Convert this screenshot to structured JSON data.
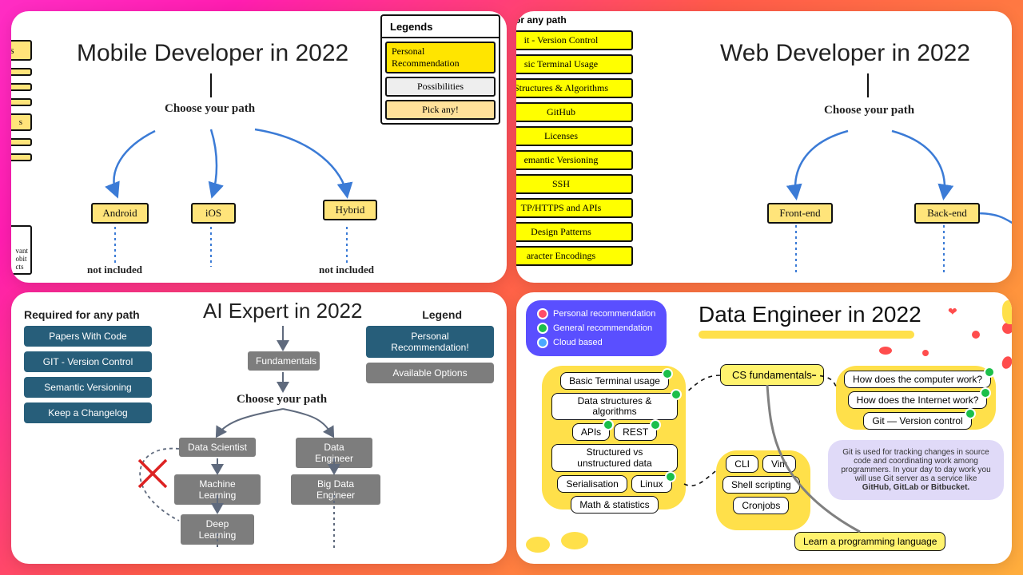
{
  "mobile": {
    "title": "Mobile Developer in 2022",
    "choose": "Choose your path",
    "paths": [
      "Android",
      "iOS",
      "Hybrid"
    ],
    "not_included": "not included",
    "legend_title": "Legends",
    "legend": [
      "Personal Recommendation",
      "Possibilities",
      "Pick any!"
    ],
    "crop_strip": [
      "ms"
    ]
  },
  "web": {
    "title": "Web Developer in 2022",
    "choose": "Choose your path",
    "paths": [
      "Front-end",
      "Back-end"
    ],
    "sidebar_title": "for any path",
    "sidebar": [
      "it - Version Control",
      "sic Terminal Usage",
      "Structures & Algorithms",
      "GitHub",
      "Licenses",
      "emantic Versioning",
      "SSH",
      "TP/HTTPS and APIs",
      "Design Patterns",
      "aracter Encodings"
    ]
  },
  "ai": {
    "title": "AI Expert in 2022",
    "choose": "Choose your path",
    "req_title": "Required for any path",
    "required": [
      "Papers With Code",
      "GIT - Version Control",
      "Semantic Versioning",
      "Keep a Changelog"
    ],
    "legend_title": "Legend",
    "legend": [
      "Personal Recommendation!",
      "Available Options"
    ],
    "nodes": {
      "fundamentals": "Fundamentals",
      "data_scientist": "Data Scientist",
      "data_engineer": "Data Engineer",
      "machine_learning": "Machine Learning",
      "big_data_engineer": "Big Data Engineer",
      "deep_learning": "Deep Learning"
    }
  },
  "de": {
    "title": "Data Engineer in 2022",
    "legend": {
      "personal": "Personal recommendation",
      "general": "General recommendation",
      "cloud": "Cloud based"
    },
    "root": "CS fundamentals",
    "left_group": [
      "Basic Terminal usage",
      "Data structures & algorithms",
      "APIs",
      "REST",
      "Structured vs unstructured data",
      "Serialisation",
      "Linux",
      "Math & statistics"
    ],
    "cli_group": [
      "CLI",
      "Vim",
      "Shell scripting",
      "Cronjobs"
    ],
    "right_group": [
      "How does the computer work?",
      "How does the Internet work?",
      "Git — Version control"
    ],
    "info": "Git is used for tracking changes in source code and coordinating work among programmers. In your day to day work you will use Git server as a service like",
    "info_bold": "GitHub, GitLab or Bitbucket.",
    "bottom": "Learn a programming language"
  }
}
